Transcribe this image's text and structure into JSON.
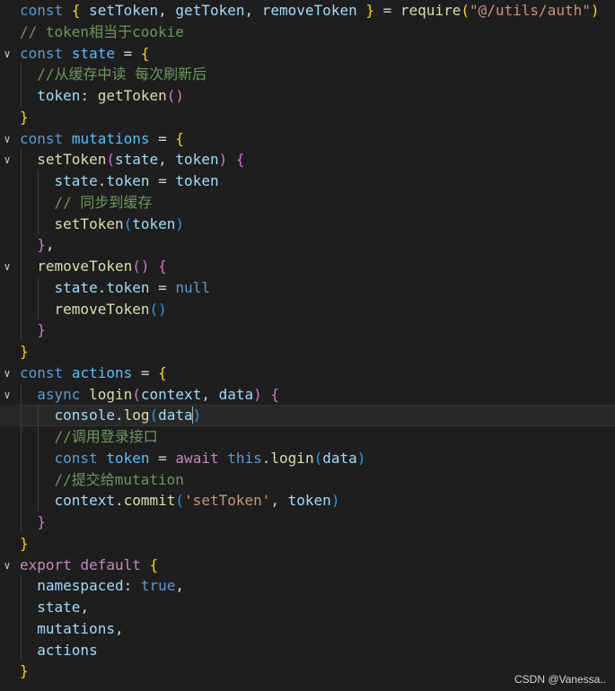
{
  "colors": {
    "kw": "#569cd6",
    "ctrl": "#c586c0",
    "fn": "#dcdcaa",
    "var": "#9cdcfe",
    "const": "#4fc1ff",
    "str": "#ce9178",
    "comment": "#6a9955",
    "punct": "#d4d4d4",
    "b1": "#ffd700",
    "b2": "#da70d6",
    "b3": "#179fff"
  },
  "active_line": 19,
  "lines": [
    {
      "fold": false,
      "tokens": [
        [
          "const",
          "kw"
        ],
        [
          " ",
          "punct"
        ],
        [
          "{",
          "b1"
        ],
        [
          " ",
          "punct"
        ],
        [
          "setToken",
          "var"
        ],
        [
          ", ",
          "punct"
        ],
        [
          "getToken",
          "var"
        ],
        [
          ", ",
          "punct"
        ],
        [
          "removeToken",
          "var"
        ],
        [
          " ",
          "punct"
        ],
        [
          "}",
          "b1"
        ],
        [
          " = ",
          "punct"
        ],
        [
          "require",
          "fn"
        ],
        [
          "(",
          "b1"
        ],
        [
          "\"@/utils/auth\"",
          "str"
        ],
        [
          ")",
          "b1"
        ]
      ]
    },
    {
      "fold": false,
      "tokens": [
        [
          "// token相当于cookie",
          "comment"
        ]
      ]
    },
    {
      "fold": true,
      "tokens": [
        [
          "const",
          "kw"
        ],
        [
          " ",
          "punct"
        ],
        [
          "state",
          "const"
        ],
        [
          " = ",
          "punct"
        ],
        [
          "{",
          "b1"
        ]
      ]
    },
    {
      "fold": false,
      "tokens": [
        [
          "  ",
          "punct"
        ],
        [
          "//从缓存中读 每次刷新后",
          "comment"
        ]
      ]
    },
    {
      "fold": false,
      "tokens": [
        [
          "  ",
          "punct"
        ],
        [
          "token",
          "var"
        ],
        [
          ": ",
          "punct"
        ],
        [
          "getToken",
          "fn"
        ],
        [
          "()",
          "b2"
        ]
      ]
    },
    {
      "fold": false,
      "tokens": [
        [
          "}",
          "b1"
        ]
      ]
    },
    {
      "fold": true,
      "tokens": [
        [
          "const",
          "kw"
        ],
        [
          " ",
          "punct"
        ],
        [
          "mutations",
          "const"
        ],
        [
          " = ",
          "punct"
        ],
        [
          "{",
          "b1"
        ]
      ]
    },
    {
      "fold": true,
      "tokens": [
        [
          "  ",
          "punct"
        ],
        [
          "setToken",
          "fn"
        ],
        [
          "(",
          "b2"
        ],
        [
          "state",
          "var"
        ],
        [
          ", ",
          "punct"
        ],
        [
          "token",
          "var"
        ],
        [
          ")",
          "b2"
        ],
        [
          " ",
          "punct"
        ],
        [
          "{",
          "b2"
        ]
      ]
    },
    {
      "fold": false,
      "tokens": [
        [
          "    ",
          "punct"
        ],
        [
          "state",
          "var"
        ],
        [
          ".",
          "punct"
        ],
        [
          "token",
          "var"
        ],
        [
          " = ",
          "punct"
        ],
        [
          "token",
          "var"
        ]
      ]
    },
    {
      "fold": false,
      "tokens": [
        [
          "    ",
          "punct"
        ],
        [
          "// 同步到缓存",
          "comment"
        ]
      ]
    },
    {
      "fold": false,
      "tokens": [
        [
          "    ",
          "punct"
        ],
        [
          "setToken",
          "fn"
        ],
        [
          "(",
          "b3"
        ],
        [
          "token",
          "var"
        ],
        [
          ")",
          "b3"
        ]
      ]
    },
    {
      "fold": false,
      "tokens": [
        [
          "  ",
          "punct"
        ],
        [
          "}",
          "b2"
        ],
        [
          ",",
          "punct"
        ]
      ]
    },
    {
      "fold": true,
      "tokens": [
        [
          "  ",
          "punct"
        ],
        [
          "removeToken",
          "fn"
        ],
        [
          "()",
          "b2"
        ],
        [
          " ",
          "punct"
        ],
        [
          "{",
          "b2"
        ]
      ]
    },
    {
      "fold": false,
      "tokens": [
        [
          "    ",
          "punct"
        ],
        [
          "state",
          "var"
        ],
        [
          ".",
          "punct"
        ],
        [
          "token",
          "var"
        ],
        [
          " = ",
          "punct"
        ],
        [
          "null",
          "kw"
        ]
      ]
    },
    {
      "fold": false,
      "tokens": [
        [
          "    ",
          "punct"
        ],
        [
          "removeToken",
          "fn"
        ],
        [
          "()",
          "b3"
        ]
      ]
    },
    {
      "fold": false,
      "tokens": [
        [
          "  ",
          "punct"
        ],
        [
          "}",
          "b2"
        ]
      ]
    },
    {
      "fold": false,
      "tokens": [
        [
          "}",
          "b1"
        ]
      ]
    },
    {
      "fold": true,
      "tokens": [
        [
          "const",
          "kw"
        ],
        [
          " ",
          "punct"
        ],
        [
          "actions",
          "const"
        ],
        [
          " = ",
          "punct"
        ],
        [
          "{",
          "b1"
        ]
      ]
    },
    {
      "fold": true,
      "tokens": [
        [
          "  ",
          "punct"
        ],
        [
          "async",
          "kw"
        ],
        [
          " ",
          "punct"
        ],
        [
          "login",
          "fn"
        ],
        [
          "(",
          "b2"
        ],
        [
          "context",
          "var"
        ],
        [
          ", ",
          "punct"
        ],
        [
          "data",
          "var"
        ],
        [
          ")",
          "b2"
        ],
        [
          " ",
          "punct"
        ],
        [
          "{",
          "b2"
        ]
      ]
    },
    {
      "fold": false,
      "tokens": [
        [
          "    ",
          "punct"
        ],
        [
          "console",
          "var"
        ],
        [
          ".",
          "punct"
        ],
        [
          "log",
          "fn"
        ],
        [
          "(",
          "b3"
        ],
        [
          "data",
          "var"
        ],
        [
          ")",
          "b3"
        ]
      ]
    },
    {
      "fold": false,
      "tokens": [
        [
          "    ",
          "punct"
        ],
        [
          "//调用登录接口",
          "comment"
        ]
      ]
    },
    {
      "fold": false,
      "tokens": [
        [
          "    ",
          "punct"
        ],
        [
          "const",
          "kw"
        ],
        [
          " ",
          "punct"
        ],
        [
          "token",
          "const"
        ],
        [
          " = ",
          "punct"
        ],
        [
          "await",
          "ctrl"
        ],
        [
          " ",
          "punct"
        ],
        [
          "this",
          "kw"
        ],
        [
          ".",
          "punct"
        ],
        [
          "login",
          "fn"
        ],
        [
          "(",
          "b3"
        ],
        [
          "data",
          "var"
        ],
        [
          ")",
          "b3"
        ]
      ]
    },
    {
      "fold": false,
      "tokens": [
        [
          "    ",
          "punct"
        ],
        [
          "//提交给mutation",
          "comment"
        ]
      ]
    },
    {
      "fold": false,
      "tokens": [
        [
          "    ",
          "punct"
        ],
        [
          "context",
          "var"
        ],
        [
          ".",
          "punct"
        ],
        [
          "commit",
          "fn"
        ],
        [
          "(",
          "b3"
        ],
        [
          "'setToken'",
          "str"
        ],
        [
          ", ",
          "punct"
        ],
        [
          "token",
          "var"
        ],
        [
          ")",
          "b3"
        ]
      ]
    },
    {
      "fold": false,
      "tokens": [
        [
          "  ",
          "punct"
        ],
        [
          "}",
          "b2"
        ]
      ]
    },
    {
      "fold": false,
      "tokens": [
        [
          "}",
          "b1"
        ]
      ]
    },
    {
      "fold": true,
      "tokens": [
        [
          "export",
          "ctrl"
        ],
        [
          " ",
          "punct"
        ],
        [
          "default",
          "ctrl"
        ],
        [
          " ",
          "punct"
        ],
        [
          "{",
          "b1"
        ]
      ]
    },
    {
      "fold": false,
      "tokens": [
        [
          "  ",
          "punct"
        ],
        [
          "namespaced",
          "var"
        ],
        [
          ": ",
          "punct"
        ],
        [
          "true",
          "kw"
        ],
        [
          ",",
          "punct"
        ]
      ]
    },
    {
      "fold": false,
      "tokens": [
        [
          "  ",
          "punct"
        ],
        [
          "state",
          "var"
        ],
        [
          ",",
          "punct"
        ]
      ]
    },
    {
      "fold": false,
      "tokens": [
        [
          "  ",
          "punct"
        ],
        [
          "mutations",
          "var"
        ],
        [
          ",",
          "punct"
        ]
      ]
    },
    {
      "fold": false,
      "tokens": [
        [
          "  ",
          "punct"
        ],
        [
          "actions",
          "var"
        ]
      ]
    },
    {
      "fold": false,
      "tokens": [
        [
          "}",
          "b1"
        ]
      ]
    }
  ],
  "fold_icon": "chevron-down-icon",
  "watermark": "CSDN @Vanessa.."
}
